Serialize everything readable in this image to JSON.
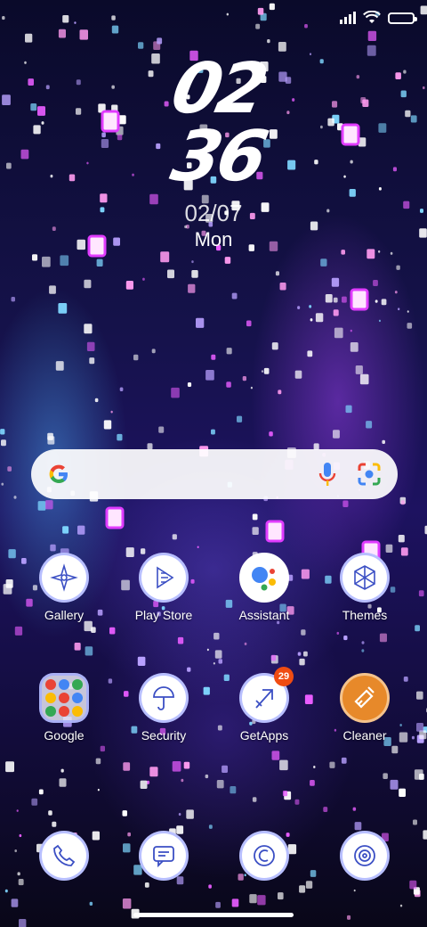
{
  "status_bar": {
    "icons": [
      "signal-icon",
      "wifi-icon",
      "battery-icon"
    ]
  },
  "clock": {
    "hours": "02",
    "minutes": "36"
  },
  "date": {
    "date": "02/07",
    "weekday": "Mon"
  },
  "search_bar": {
    "icons": [
      "google-g-icon",
      "microphone-icon",
      "lens-icon"
    ]
  },
  "apps_row1": [
    {
      "label": "Gallery",
      "icon": "gallery-icon"
    },
    {
      "label": "Play Store",
      "icon": "play-store-icon"
    },
    {
      "label": "Assistant",
      "icon": "assistant-icon"
    },
    {
      "label": "Themes",
      "icon": "themes-icon"
    }
  ],
  "apps_row2": [
    {
      "label": "Google",
      "icon": "google-folder-icon"
    },
    {
      "label": "Security",
      "icon": "security-icon"
    },
    {
      "label": "GetApps",
      "icon": "getapps-icon",
      "badge": "29"
    },
    {
      "label": "Cleaner",
      "icon": "cleaner-icon"
    }
  ],
  "dock": [
    {
      "icon": "phone-icon"
    },
    {
      "icon": "messages-icon"
    },
    {
      "icon": "browser-icon"
    },
    {
      "icon": "camera-icon"
    }
  ],
  "colors": {
    "badge": "#f04c12",
    "cleaner": "#e7892a",
    "wallpaper_dark": "#0a0a2a",
    "wallpaper_purple": "#1d1260"
  }
}
